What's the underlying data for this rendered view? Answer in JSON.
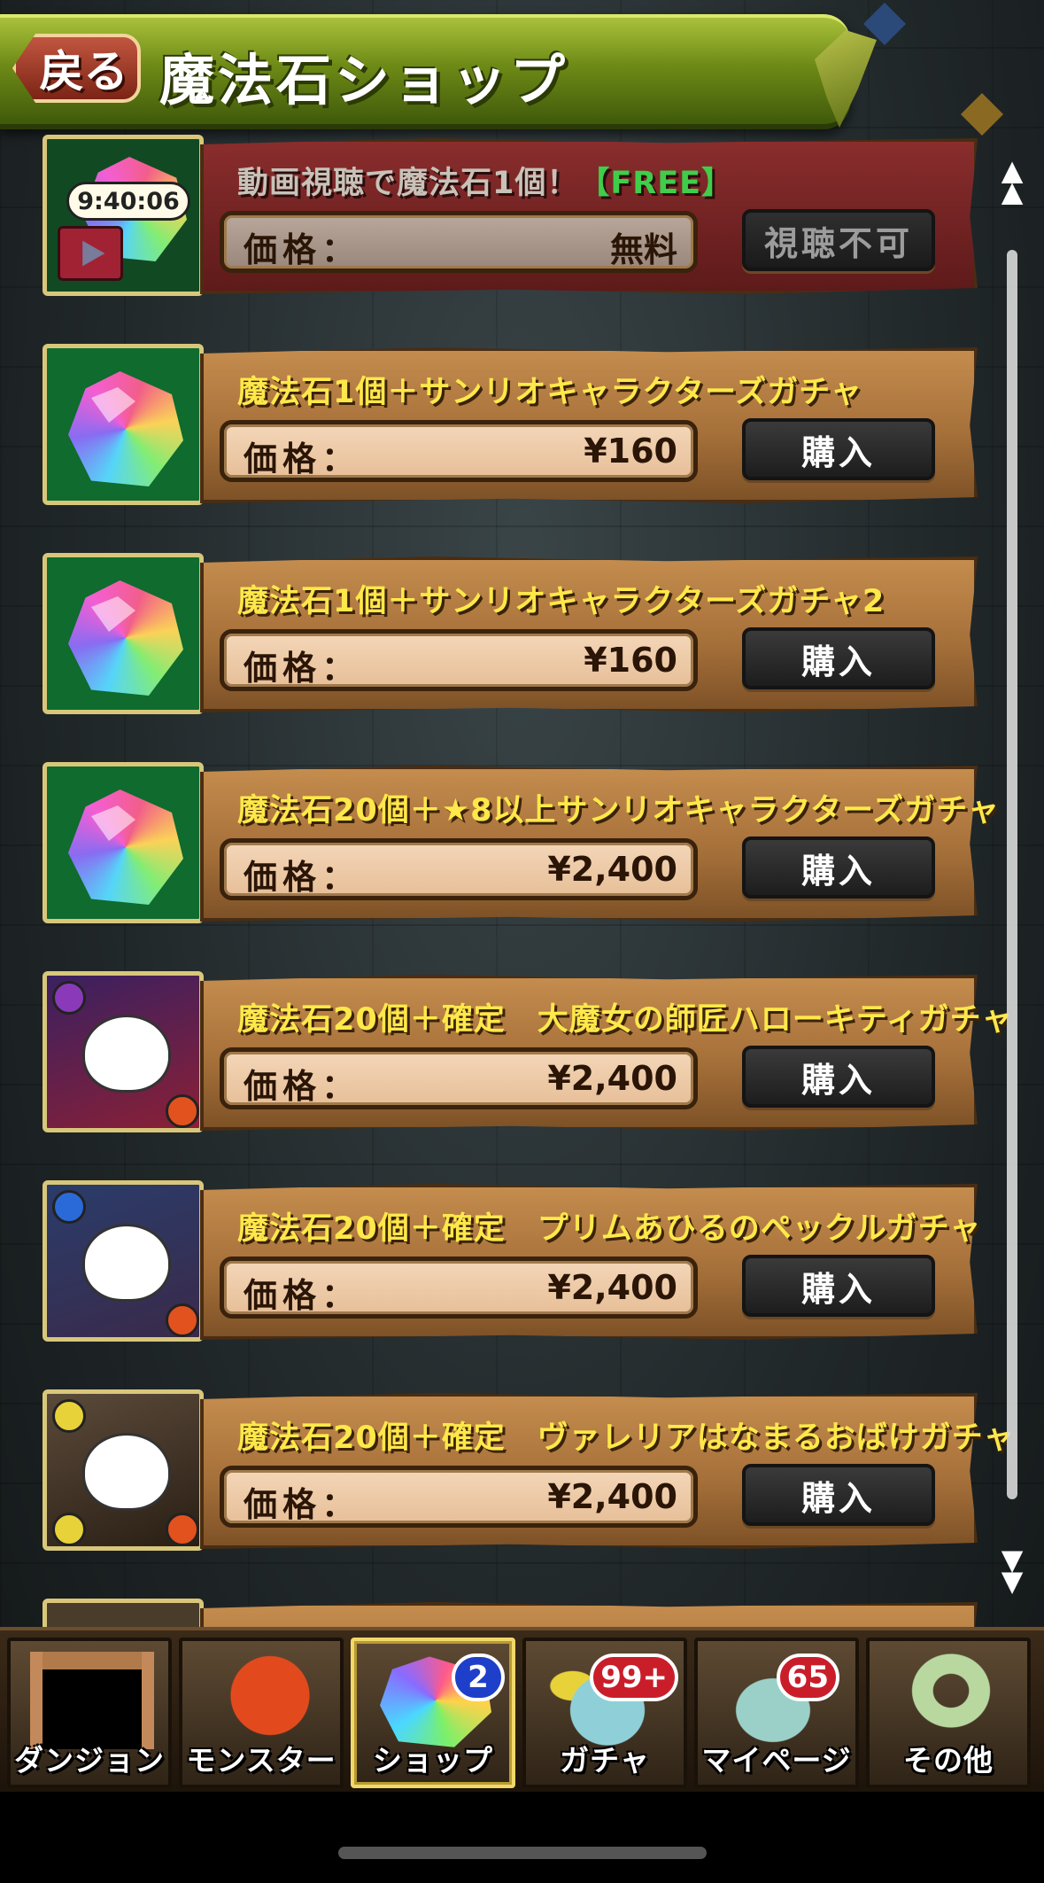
{
  "header": {
    "back_label": "戻る",
    "title": "魔法石ショップ"
  },
  "items": [
    {
      "name": "動画視聴で魔法石1個！",
      "tag": "【FREE】",
      "price_label": "価格：",
      "price": "無料",
      "action": "視聴不可",
      "timer": "9:40:06",
      "free": true
    },
    {
      "name": "魔法石1個＋サンリオキャラクターズガチャ",
      "price_label": "価格：",
      "price": "¥160",
      "action": "購入"
    },
    {
      "name": "魔法石1個＋サンリオキャラクターズガチャ2",
      "price_label": "価格：",
      "price": "¥160",
      "action": "購入"
    },
    {
      "name": "魔法石20個＋★8以上サンリオキャラクターズガチャ",
      "price_label": "価格：",
      "price": "¥2,400",
      "action": "購入"
    },
    {
      "name": "魔法石20個＋確定　大魔女の師匠ハローキティガチャ",
      "price_label": "価格：",
      "price": "¥2,400",
      "action": "購入"
    },
    {
      "name": "魔法石20個＋確定　プリムあひるのペックルガチャ",
      "price_label": "価格：",
      "price": "¥2,400",
      "action": "購入"
    },
    {
      "name": "魔法石20個＋確定　ヴァレリアはなまるおばけガチャ",
      "price_label": "価格：",
      "price": "¥2,400",
      "action": "購入"
    }
  ],
  "nav": [
    {
      "label": "ダンジョン",
      "icon": "dungeon-icon"
    },
    {
      "label": "モンスター",
      "icon": "monster-icon"
    },
    {
      "label": "ショップ",
      "icon": "shop-icon",
      "badge": "2",
      "active": true
    },
    {
      "label": "ガチャ",
      "icon": "gacha-icon",
      "badge": "99+"
    },
    {
      "label": "マイページ",
      "icon": "mypage-icon",
      "badge": "65"
    },
    {
      "label": "その他",
      "icon": "other-icon"
    }
  ],
  "colors": {
    "header_green": "#6e8a16",
    "name_yellow": "#ffe84a",
    "free_green": "#3fce4a",
    "badge_blue": "#1e3fc9",
    "badge_red": "#c91e2a"
  }
}
